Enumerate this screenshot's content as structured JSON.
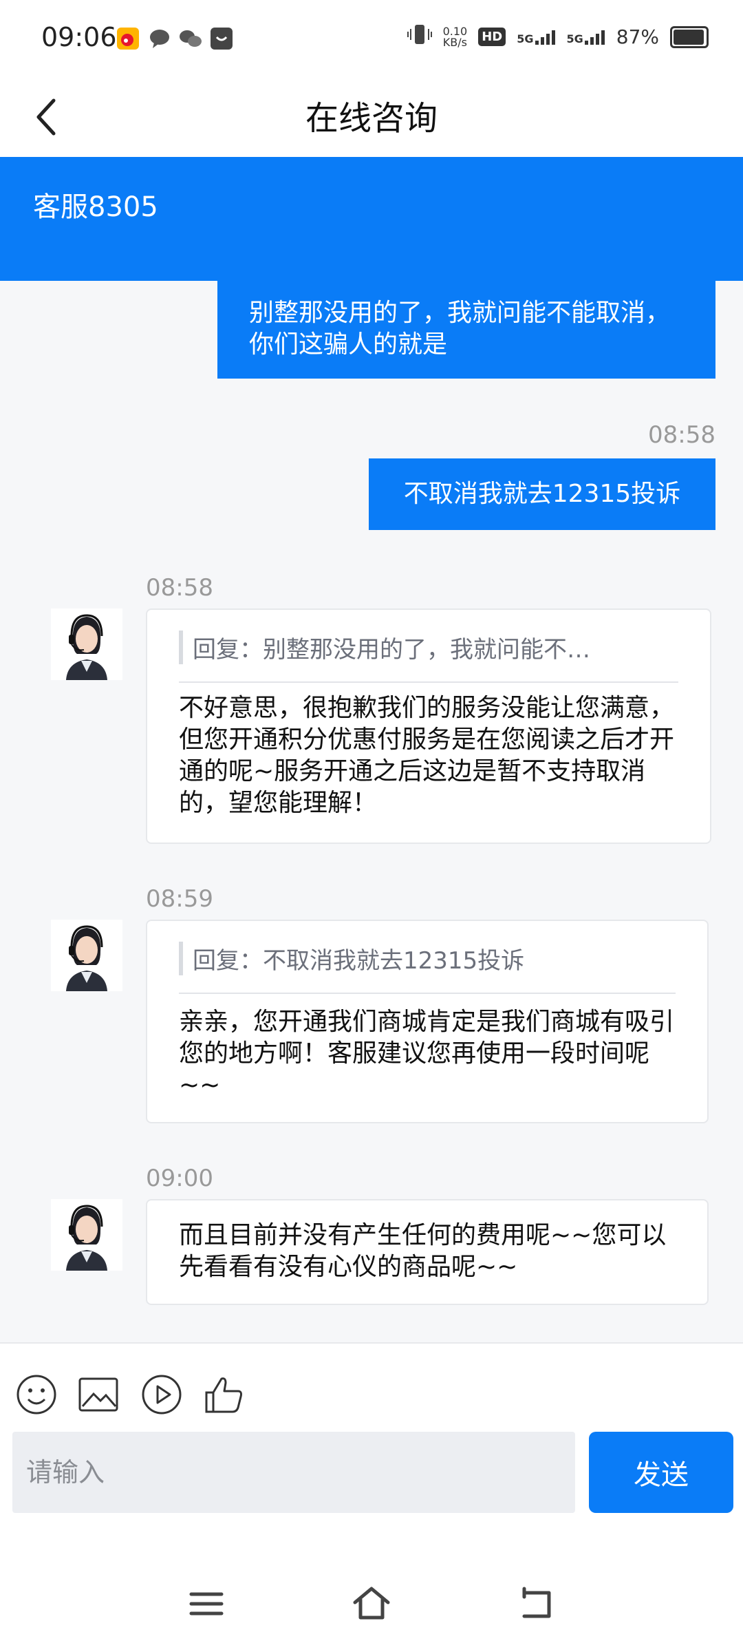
{
  "status_bar": {
    "time": "09:06",
    "net_speed_value": "0.10",
    "net_speed_unit": "KB/s",
    "hd_label": "HD",
    "sim1": "5G",
    "sim2": "5G",
    "battery_text": "87%",
    "battery_level": 0.87,
    "icons": [
      "weibo-icon",
      "message-icon",
      "wechat-icon",
      "shop-icon",
      "vibrate-icon",
      "hd-icon",
      "signal-icon",
      "battery-icon"
    ]
  },
  "header": {
    "title": "在线咨询",
    "back_icon": "chevron-left-icon"
  },
  "agent_banner": {
    "name": "客服8305"
  },
  "conversation": {
    "user_messages": [
      {
        "text": "别整那没用的了，我就问能不能取消，你们这骗人的就是"
      },
      {
        "time": "08:58",
        "text": "不取消我就去12315投诉"
      }
    ],
    "agent_messages": [
      {
        "time": "08:58",
        "quote": "回复：别整那没用的了，我就问能不…",
        "text": "不好意思，很抱歉我们的服务没能让您满意，但您开通积分优惠付服务是在您阅读之后才开通的呢~服务开通之后这边是暂不支持取消的，望您能理解！"
      },
      {
        "time": "08:59",
        "quote": "回复：不取消我就去12315投诉",
        "text": "亲亲，您开通我们商城肯定是我们商城有吸引您的地方啊！客服建议您再使用一段时间呢~~"
      },
      {
        "time": "09:00",
        "text": "而且目前并没有产生任何的费用呢~~您可以先看看有没有心仪的商品呢~~"
      }
    ]
  },
  "input_bar": {
    "tools": [
      "emoji-icon",
      "image-icon",
      "video-icon",
      "thumbs-up-icon"
    ],
    "placeholder": "请输入",
    "send_label": "发送"
  },
  "nav_bar": {
    "icons": [
      "menu-icon",
      "home-icon",
      "back-icon"
    ]
  },
  "colors": {
    "accent": "#0a7cf7",
    "background": "#f6f7f9"
  }
}
